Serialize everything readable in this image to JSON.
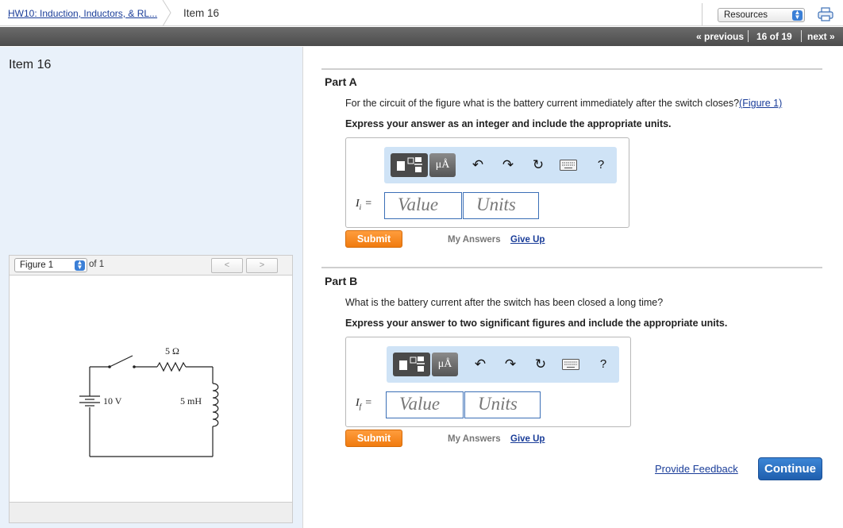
{
  "header": {
    "breadcrumb_assignment": "HW10: Induction, Inductors, & RL...",
    "breadcrumb_item": "Item 16",
    "resources_select": "Resources"
  },
  "nav": {
    "previous": "« previous",
    "count": "16 of 19",
    "next": "next »"
  },
  "left": {
    "item_title": "Item 16",
    "figure_select": "Figure 1",
    "figure_of": "of 1",
    "prev_btn": "<",
    "next_btn": ">",
    "circuit": {
      "resistor": "5 Ω",
      "inductor": "5 mH",
      "battery": "10 V"
    }
  },
  "partA": {
    "title": "Part A",
    "question": "For the circuit of the figure what is the battery current immediately after the switch closes?",
    "figure_link": "(Figure 1)",
    "instructions": "Express your answer as an integer and include the appropriate units.",
    "var_symbol": "I",
    "var_sub": "i",
    "eq": "=",
    "value_placeholder": "Value",
    "units_placeholder": "Units",
    "submit": "Submit",
    "my_answers": "My Answers",
    "give_up": "Give Up"
  },
  "partB": {
    "title": "Part B",
    "question": "What is the battery current after the switch has been closed a long time?",
    "instructions": "Express your answer to two significant figures and include the appropriate units.",
    "var_symbol": "I",
    "var_sub": "f",
    "eq": "=",
    "value_placeholder": "Value",
    "units_placeholder": "Units",
    "submit": "Submit",
    "my_answers": "My Answers",
    "give_up": "Give Up"
  },
  "toolbar": {
    "mu_label": "μÅ",
    "help": "?"
  },
  "footer": {
    "feedback": "Provide Feedback",
    "continue": "Continue"
  },
  "colors": {
    "accent": "#1f5fae",
    "submit": "#f07b0f",
    "link": "#1a3d99",
    "left_bg": "#e9f1fa"
  },
  "icons": [
    "template-icon",
    "undo-icon",
    "redo-icon",
    "reset-icon",
    "keyboard-icon",
    "help-icon",
    "printer-icon",
    "select-arrow-icon"
  ]
}
